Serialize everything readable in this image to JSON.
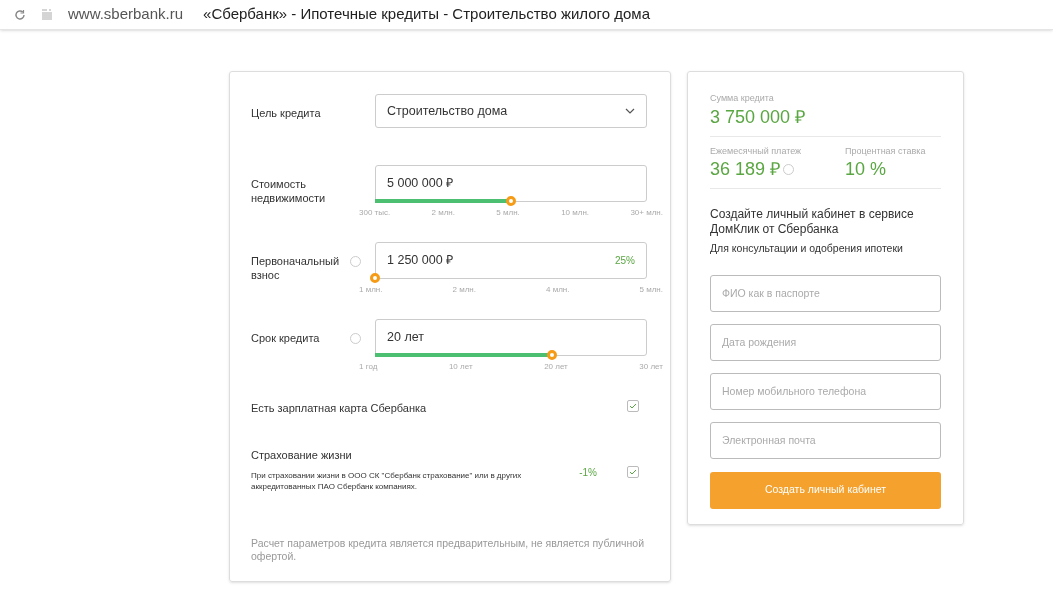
{
  "browser": {
    "url": "www.sberbank.ru",
    "page_title": "«Сбербанк» - Ипотечные кредиты - Строительство жилого дома"
  },
  "calculator": {
    "fields": [
      {
        "kind": "select",
        "label": "Цель кредита",
        "info": false,
        "value": "Строительство дома"
      },
      {
        "kind": "slider",
        "label": "Стоимость недвижимости",
        "info": false,
        "value": "5 000 000 ₽",
        "level": 0.5,
        "ticks": [
          "300 тыс.",
          "2 млн.",
          "5 млн.",
          "10 млн.",
          "30+ млн."
        ]
      },
      {
        "kind": "slider",
        "label": "Первоначальный взнос",
        "info": true,
        "value": "1 250 000 ₽",
        "badge": "25%",
        "level": 0,
        "ticks": [
          "1 млн.",
          "2 млн.",
          "4 млн.",
          "5 млн."
        ]
      },
      {
        "kind": "slider",
        "label": "Срок кредита",
        "info": true,
        "value": "20 лет",
        "level": 0.65,
        "ticks": [
          "1 год",
          "10 лет",
          "20 лет",
          "30 лет"
        ]
      }
    ],
    "options": [
      {
        "label": "Есть зарплатная карта Сбербанка",
        "checked": true
      },
      {
        "label": "Страхование жизни",
        "note": "При страховании жизни в ООО СК \"Сбербанк страхование\" или в других аккредитованных ПАО Сбербанк компаниях.",
        "discount": "-1%",
        "checked": true
      }
    ],
    "disclaimer": "Расчет параметров кредита является предварительным, не является публичной офертой."
  },
  "summary": {
    "loan_amount": {
      "label": "Сумма кредита",
      "value": "3 750 000 ₽"
    },
    "monthly_payment": {
      "label": "Ежемесячный платеж",
      "value": "36 189 ₽"
    },
    "interest_rate": {
      "label": "Процентная ставка",
      "value": "10 %"
    },
    "heading": "Создайте личный кабинет в сервисе ДомКлик от Сбербанка",
    "subheading": "Для консультации и одобрения ипотеки",
    "inputs": [
      {
        "placeholder": "ФИО как в паспорте"
      },
      {
        "placeholder": "Дата рождения"
      },
      {
        "placeholder": "Номер мобильного телефона"
      },
      {
        "placeholder": "Электронная почта"
      }
    ],
    "button": "Создать личный кабинет"
  }
}
